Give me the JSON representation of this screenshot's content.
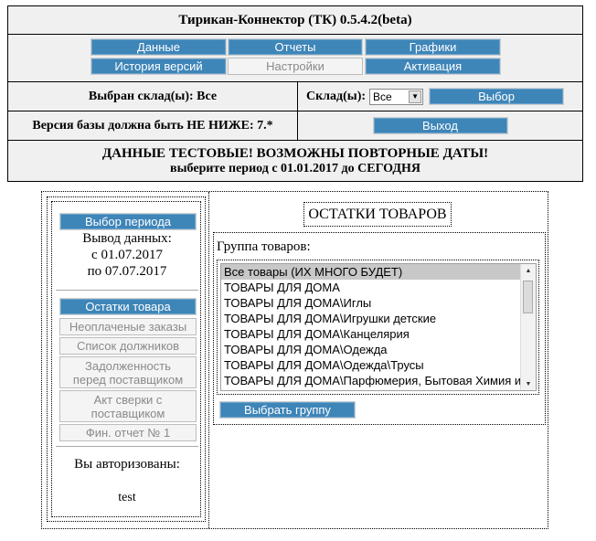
{
  "app": {
    "title": "Тирикан-Коннектор   (ТК)   0.5.4.2(beta)"
  },
  "nav": {
    "data": "Данные",
    "reports": "Отчеты",
    "charts": "Графики",
    "history": "История версий",
    "settings": "Настройки",
    "activation": "Активация"
  },
  "warehouse": {
    "selected_text": "Выбран склад(ы): Все",
    "label": "Склад(ы):",
    "select_value": "Все",
    "select_button": "Выбор"
  },
  "version": {
    "requirement": "Версия базы должна быть НЕ НИЖЕ: 7.*",
    "exit_button": "Выход"
  },
  "warning": {
    "line1": "ДАННЫЕ ТЕСТОВЫЕ! ВОЗМОЖНЫ ПОВТОРНЫЕ ДАТЫ!",
    "line2": "выберите период с 01.01.2017 до СЕГОДНЯ"
  },
  "sidebar": {
    "period_button": "Выбор периода",
    "output_label": "Вывод данных:",
    "from": "с 01.07.2017",
    "to": "по 07.07.2017",
    "items": [
      {
        "label": "Остатки товара",
        "active": true
      },
      {
        "label": "Неоплаченые заказы",
        "active": false
      },
      {
        "label": "Список должников",
        "active": false
      },
      {
        "label": "Задолженность\nперед поставщиком",
        "active": false
      },
      {
        "label": "Акт сверки с\nпоставщиком",
        "active": false
      },
      {
        "label": "Фин. отчет № 1",
        "active": false
      }
    ],
    "auth_label": "Вы авторизованы:",
    "user": "test"
  },
  "content": {
    "title": "ОСТАТКИ ТОВАРОВ",
    "group_label": "Группа товаров:",
    "groups": [
      "Все товары (ИХ МНОГО БУДЕТ)",
      "ТОВАРЫ ДЛЯ ДОМА",
      "ТОВАРЫ ДЛЯ ДОМА\\Иглы",
      "ТОВАРЫ ДЛЯ ДОМА\\Игрушки детские",
      "ТОВАРЫ ДЛЯ ДОМА\\Канцелярия",
      "ТОВАРЫ ДЛЯ ДОМА\\Одежда",
      "ТОВАРЫ ДЛЯ ДОМА\\Одежда\\Трусы",
      "ТОВАРЫ ДЛЯ ДОМА\\Парфюмерия, Бытовая Химия и"
    ],
    "selected_group_index": 0,
    "select_group_button": "Выбрать группу"
  },
  "colors": {
    "button": "#3e85b8",
    "disabled_button": "#f4f4f4",
    "header_bg": "#f0f0f0",
    "selected_row": "#c8c8c8"
  }
}
